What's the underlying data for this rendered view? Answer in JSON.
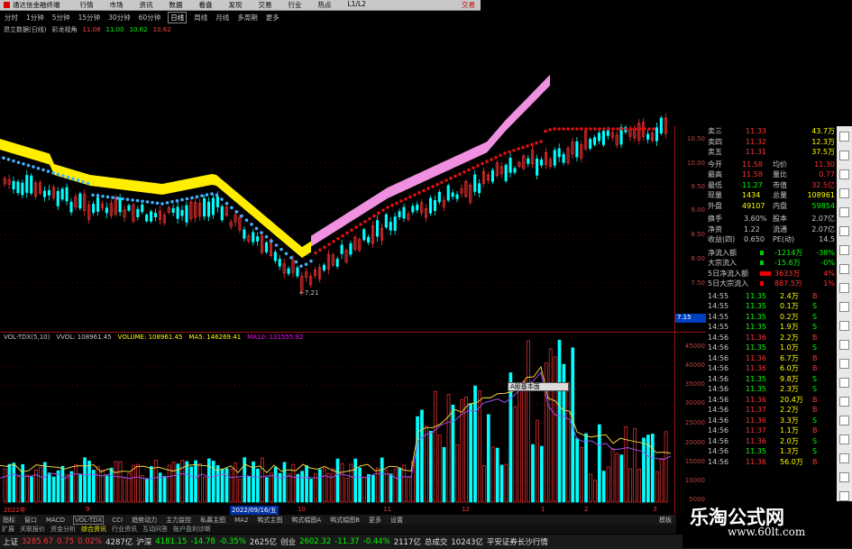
{
  "window": {
    "title": "通达信金融终端",
    "menu": [
      "行情",
      "市场",
      "资讯",
      "数据",
      "看盘",
      "发现",
      "交易",
      "行业",
      "热点",
      "L1/L2"
    ],
    "trade_label": "交易"
  },
  "period_bar": {
    "items": [
      "分时",
      "1分钟",
      "5分钟",
      "15分钟",
      "30分钟",
      "60分钟",
      "日线",
      "周线",
      "月线",
      "多周期",
      "更多"
    ],
    "active": "日线"
  },
  "indicator_bar": {
    "label1": "昂立数据(日线)",
    "label2": "彩龙视角",
    "v1": "11.08",
    "v2": "11.00",
    "v3": "10.62",
    "v4": "10.62"
  },
  "price_axis": [
    "10.50",
    "10.00",
    "9.50",
    "9.00",
    "8.50",
    "8.00",
    "7.50"
  ],
  "price_low_label": "7.21",
  "price_last_label": "7.15",
  "volume_header": {
    "indicator": "VOL-TDX(5,10)",
    "vvol": "VVOL: 108961.45",
    "volume": "VOLUME: 108961.45",
    "ma5": "MA5: 146269.41",
    "ma10": "MA10: 131555.92"
  },
  "volume_axis": [
    "45000",
    "40000",
    "35000",
    "30000",
    "25000",
    "20000",
    "15000",
    "10000",
    "5000"
  ],
  "tooltip": "A股基本面",
  "date_bar": {
    "start": "2022年",
    "selected": "2022/09/16/五",
    "marks": [
      "9",
      "10",
      "11",
      "12",
      "1",
      "2",
      "3"
    ]
  },
  "bottom_tabs": {
    "items": [
      "指标",
      "窗口",
      "MACD",
      "VOL-TDX",
      "CCI",
      "趋势动力",
      "主力监控",
      "私募主图",
      "MA2",
      "鸭式主图",
      "鸭式幅图A",
      "鸭式幅图B",
      "更多",
      "设置"
    ],
    "active": "VOL-TDX",
    "right": "模板"
  },
  "quote_panel": {
    "asks": [
      {
        "label": "卖三",
        "price": "11.33",
        "vol": "43.7万"
      },
      {
        "label": "卖四",
        "price": "11.32",
        "vol": "12.3万"
      },
      {
        "label": "卖五",
        "price": "11.31",
        "vol": "37.5万"
      }
    ],
    "stats": [
      {
        "l1": "今开",
        "v1": "11.58",
        "l2": "均价",
        "v2": "11.30"
      },
      {
        "l1": "最高",
        "v1": "11.58",
        "l2": "量比",
        "v2": "0.77"
      },
      {
        "l1": "最低",
        "v1": "11.27",
        "l2": "市值",
        "v2": "32.5亿"
      },
      {
        "l1": "现量",
        "v1": "1434",
        "l2": "总量",
        "v2": "108961"
      },
      {
        "l1": "外盘",
        "v1": "49107",
        "l2": "内盘",
        "v2": "59854"
      }
    ],
    "fin": [
      {
        "l1": "换手",
        "v1": "3.60%",
        "l2": "股本",
        "v2": "2.07亿"
      },
      {
        "l1": "净资",
        "v1": "1.22",
        "l2": "流通",
        "v2": "2.07亿"
      },
      {
        "l1": "收益(四)",
        "v1": "0.650",
        "l2": "PE(动)",
        "v2": "14.5"
      }
    ],
    "flow": [
      {
        "label": "净流入额",
        "val": "-1214万",
        "pct": "-38%"
      },
      {
        "label": "大宗流入",
        "val": "-15.6万",
        "pct": "-0%"
      },
      {
        "label": "5日净流入额",
        "val": "3633万",
        "pct": "4%"
      },
      {
        "label": "5日大宗流入",
        "val": "887.5万",
        "pct": "1%"
      }
    ],
    "ticks": [
      {
        "t": "14:55",
        "p": "11.35",
        "v": "2.4万",
        "s": "B"
      },
      {
        "t": "14:55",
        "p": "11.35",
        "v": "0.1万",
        "s": "S"
      },
      {
        "t": "14:55",
        "p": "11.35",
        "v": "0.2万",
        "s": "S"
      },
      {
        "t": "14:55",
        "p": "11.35",
        "v": "1.9万",
        "s": "S"
      },
      {
        "t": "14:56",
        "p": "11.36",
        "v": "2.2万",
        "s": "B"
      },
      {
        "t": "14:56",
        "p": "11.35",
        "v": "1.0万",
        "s": "S"
      },
      {
        "t": "14:56",
        "p": "11.36",
        "v": "6.7万",
        "s": "B"
      },
      {
        "t": "14:56",
        "p": "11.36",
        "v": "6.0万",
        "s": "B"
      },
      {
        "t": "14:56",
        "p": "11.35",
        "v": "9.8万",
        "s": "S"
      },
      {
        "t": "14:56",
        "p": "11.35",
        "v": "2.3万",
        "s": "S"
      },
      {
        "t": "14:56",
        "p": "11.36",
        "v": "20.4万",
        "s": "B"
      },
      {
        "t": "14:56",
        "p": "11.37",
        "v": "2.2万",
        "s": "B"
      },
      {
        "t": "14:56",
        "p": "11.36",
        "v": "3.3万",
        "s": "S"
      },
      {
        "t": "14:56",
        "p": "11.37",
        "v": "1.1万",
        "s": "B"
      },
      {
        "t": "14:56",
        "p": "11.36",
        "v": "2.0万",
        "s": "S"
      },
      {
        "t": "14:56",
        "p": "11.35",
        "v": "1.3万",
        "s": "S"
      },
      {
        "t": "14:56",
        "p": "11.36",
        "v": "56.0万",
        "s": "B"
      }
    ],
    "right_tab": "图文F10"
  },
  "status_bar": [
    {
      "name": "上证",
      "val": "3285.67",
      "chg": "0.75",
      "pct": "0.02%",
      "amt": "4287亿"
    },
    {
      "name": "沪深",
      "val": "4181.15",
      "chg": "-14.78",
      "pct": "-0.35%",
      "amt": "2625亿"
    },
    {
      "name": "创业",
      "val": "2602.32",
      "chg": "-11.37",
      "pct": "-0.44%",
      "amt": "2117亿"
    }
  ],
  "status_extra": {
    "label": "总成交",
    "val": "10243亿",
    "text": "平安证券长沙行情"
  },
  "watermark": {
    "title": "乐淘公式网",
    "url": "www.60lt.com"
  },
  "colors": {
    "up": "#ff3333",
    "down": "#00ffff",
    "ma_blue": "#40b0ff",
    "ma_red": "#e01010",
    "band_yellow": "#ffee00",
    "band_pink": "#f090e0",
    "grid": "#9b1010"
  }
}
